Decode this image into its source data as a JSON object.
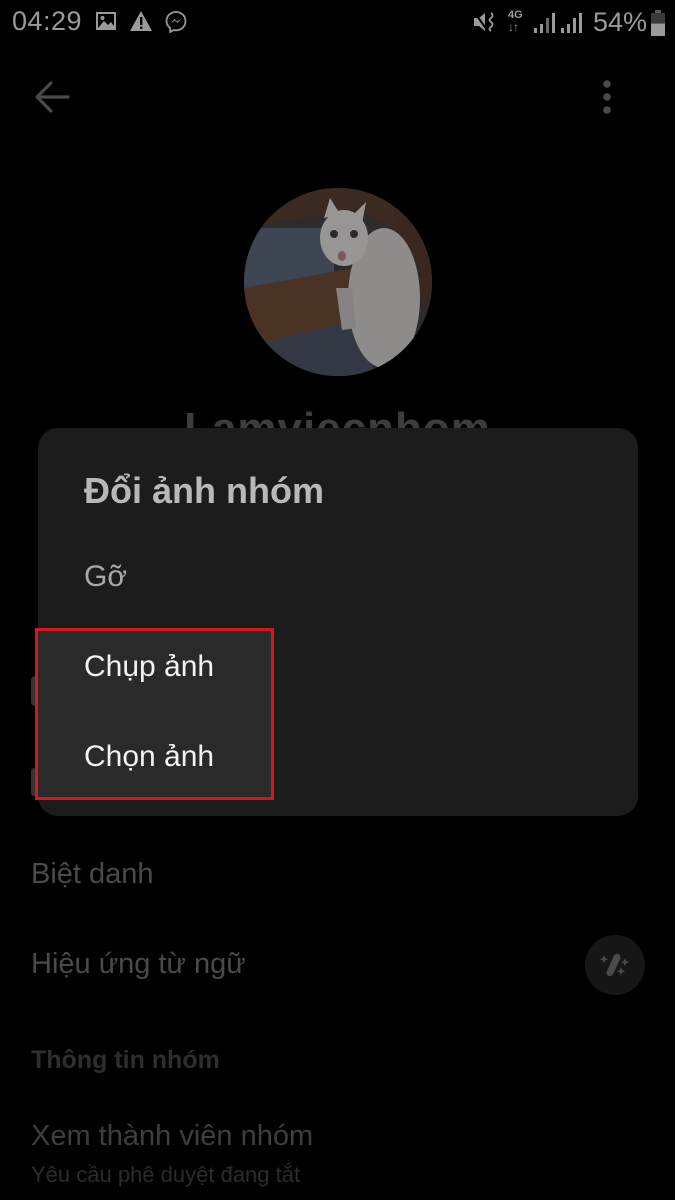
{
  "status_bar": {
    "time": "04:29",
    "left_icons": [
      "image-icon",
      "warning-icon",
      "messenger-icon"
    ],
    "right_icons": [
      "vibrate-icon",
      "4g-data-icon",
      "signal-sim1-icon",
      "signal-sim2-icon"
    ],
    "network_label": "4G",
    "battery_percent": "54%",
    "battery_level": 0.54
  },
  "app_bar": {
    "back_icon": "arrow-left-icon",
    "menu_icon": "more-vertical-icon"
  },
  "profile": {
    "avatar": "group-avatar-cat-photo",
    "group_name": "Lamviecnhom"
  },
  "background_list": {
    "items": [
      {
        "label": "Biệt danh"
      },
      {
        "label": "Hiệu ứng từ ngữ",
        "icon": "magic-wand-icon"
      }
    ],
    "section_header": "Thông tin nhóm",
    "members": {
      "label": "Xem thành viên nhóm",
      "sublabel": "Yêu cầu phê duyệt đang tắt"
    }
  },
  "dialog": {
    "title": "Đổi ảnh nhóm",
    "options": [
      {
        "label": "Gỡ"
      },
      {
        "label": "Chụp ảnh"
      },
      {
        "label": "Chọn ảnh"
      }
    ],
    "highlight_color": "#d9161b"
  }
}
